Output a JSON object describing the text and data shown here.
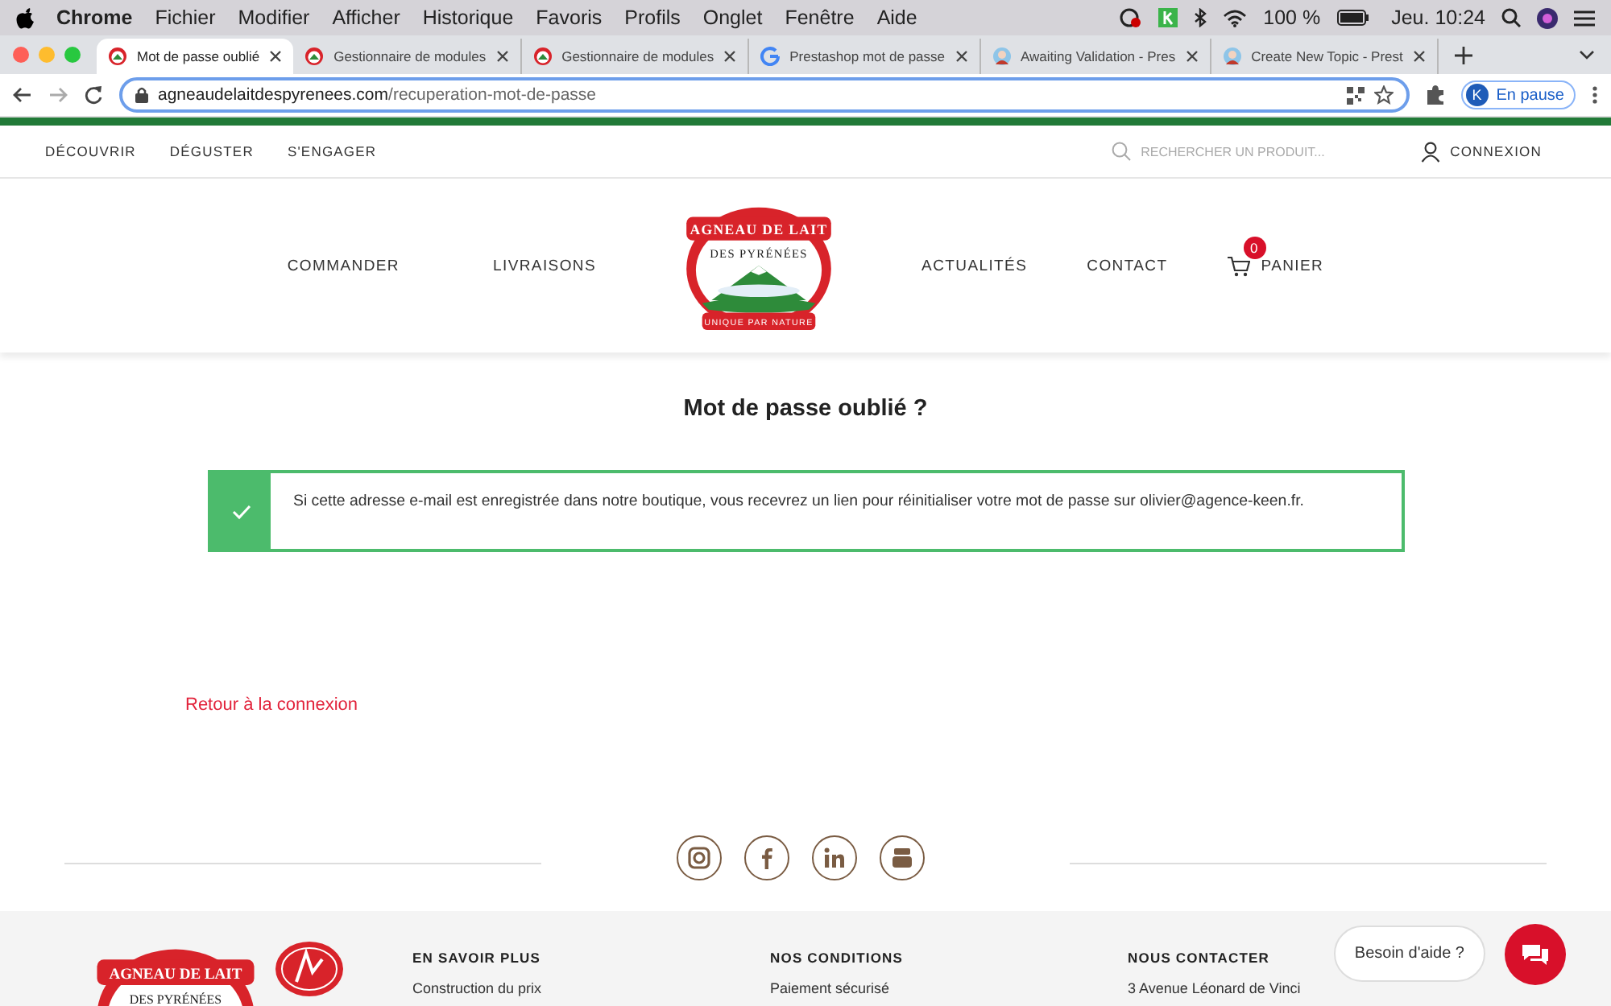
{
  "menubar": {
    "app": "Chrome",
    "menus": [
      "Fichier",
      "Modifier",
      "Afficher",
      "Historique",
      "Favoris",
      "Profils",
      "Onglet",
      "Fenêtre",
      "Aide"
    ],
    "battery": "100 %",
    "clock": "Jeu. 10:24"
  },
  "tabs": [
    {
      "title": "Mot de passe oublié",
      "selected": true,
      "kind": "logo"
    },
    {
      "title": "Gestionnaire de modules",
      "selected": false,
      "kind": "logo"
    },
    {
      "title": "Gestionnaire de modules",
      "selected": false,
      "kind": "logo"
    },
    {
      "title": "Prestashop mot de passe",
      "selected": false,
      "kind": "google"
    },
    {
      "title": "Awaiting Validation - Pres",
      "selected": false,
      "kind": "forum"
    },
    {
      "title": "Create New Topic - Prest",
      "selected": false,
      "kind": "forum"
    }
  ],
  "address": {
    "domain": "agneaudelaitdespyrenees.com",
    "path": "/recuperation-mot-de-passe"
  },
  "profile": {
    "initial": "K",
    "status": "En pause"
  },
  "site": {
    "topnav": [
      "DÉCOUVRIR",
      "DÉGUSTER",
      "S'ENGAGER"
    ],
    "search": {
      "placeholder": "RECHERCHER UN PRODUIT..."
    },
    "account": "CONNEXION",
    "nav_left": [
      "COMMANDER",
      "LIVRAISONS"
    ],
    "nav_right": [
      "ACTUALITÉS",
      "CONTACT"
    ],
    "cart": {
      "count": "0",
      "label": "PANIER"
    },
    "logo": {
      "top": "AGNEAU DE LAIT",
      "middle": "DES PYRÉNÉES",
      "bottom": "UNIQUE PAR NATURE"
    },
    "title": "Mot de passe oublié ?",
    "alert": {
      "kind": "success",
      "message": "Si cette adresse e-mail est enregistrée dans notre boutique, vous recevrez un lien pour réinitialiser votre mot de passe sur olivier@agence-keen.fr."
    },
    "back_link": "Retour à la connexion",
    "social": [
      {
        "kind": "instagram"
      },
      {
        "kind": "facebook"
      },
      {
        "kind": "linkedin"
      },
      {
        "kind": "youtube"
      }
    ],
    "footer_logo": {
      "top": "AGNEAU DE LAIT",
      "middle": "DES PYRÉNÉES"
    },
    "footer_columns": [
      {
        "heading": "EN SAVOIR PLUS",
        "link": "Construction du prix"
      },
      {
        "heading": "NOS CONDITIONS",
        "link": "Paiement sécurisé"
      },
      {
        "heading": "NOUS CONTACTER",
        "link": "3 Avenue Léonard de Vinci"
      }
    ],
    "help": "Besoin d'aide ?"
  }
}
